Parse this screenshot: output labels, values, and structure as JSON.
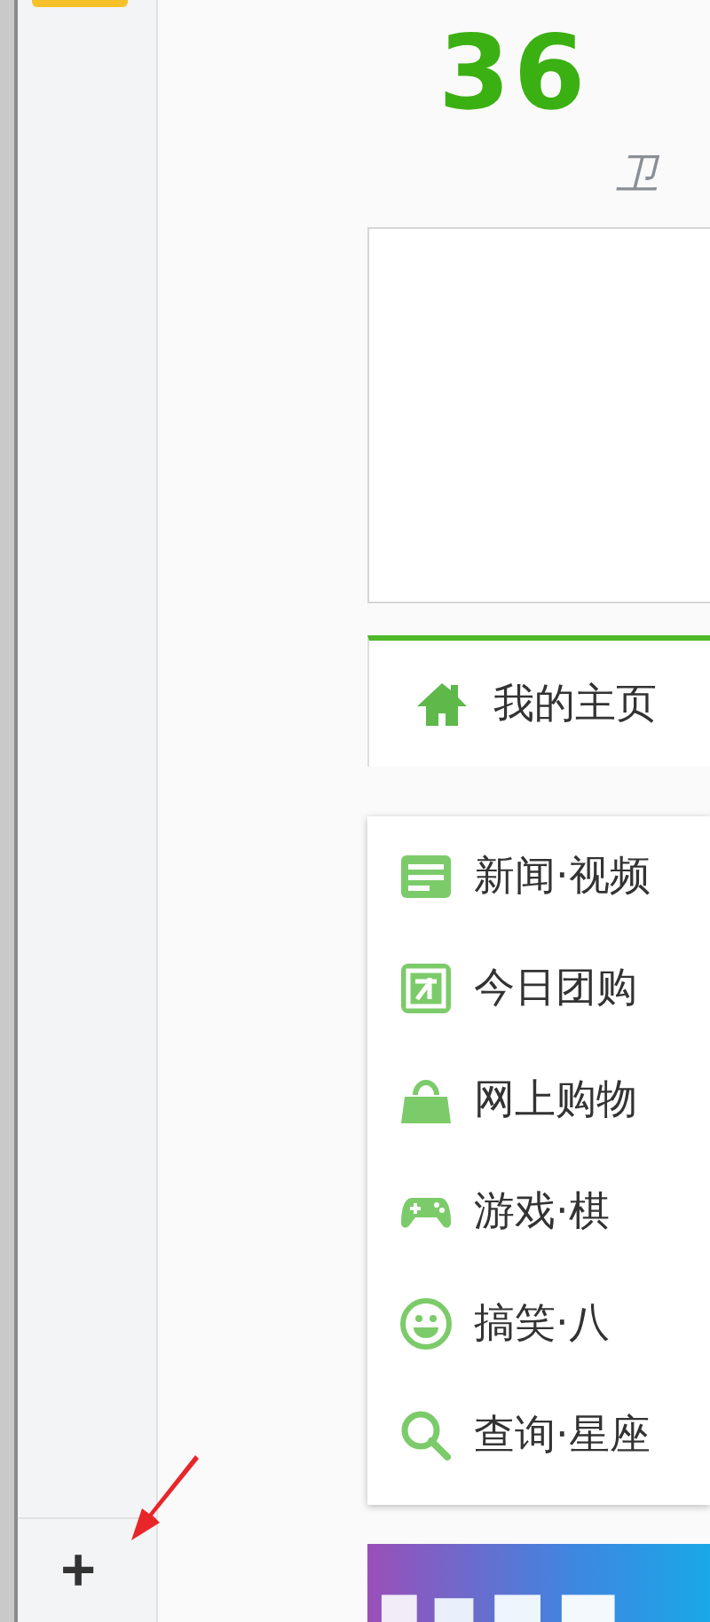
{
  "logo": {
    "mark": "36",
    "tagline": "卫"
  },
  "home_tab": {
    "label": "我的主页",
    "selected": true
  },
  "menu": [
    {
      "kind": "news",
      "label": "新闻·视频"
    },
    {
      "kind": "group",
      "label": "今日团购"
    },
    {
      "kind": "shop",
      "label": "网上购物"
    },
    {
      "kind": "game",
      "label": "游戏·棋"
    },
    {
      "kind": "fun",
      "label": "搞笑·八"
    },
    {
      "kind": "search",
      "label": "查询·星座"
    }
  ],
  "sidebar": {
    "add_label": "+"
  }
}
